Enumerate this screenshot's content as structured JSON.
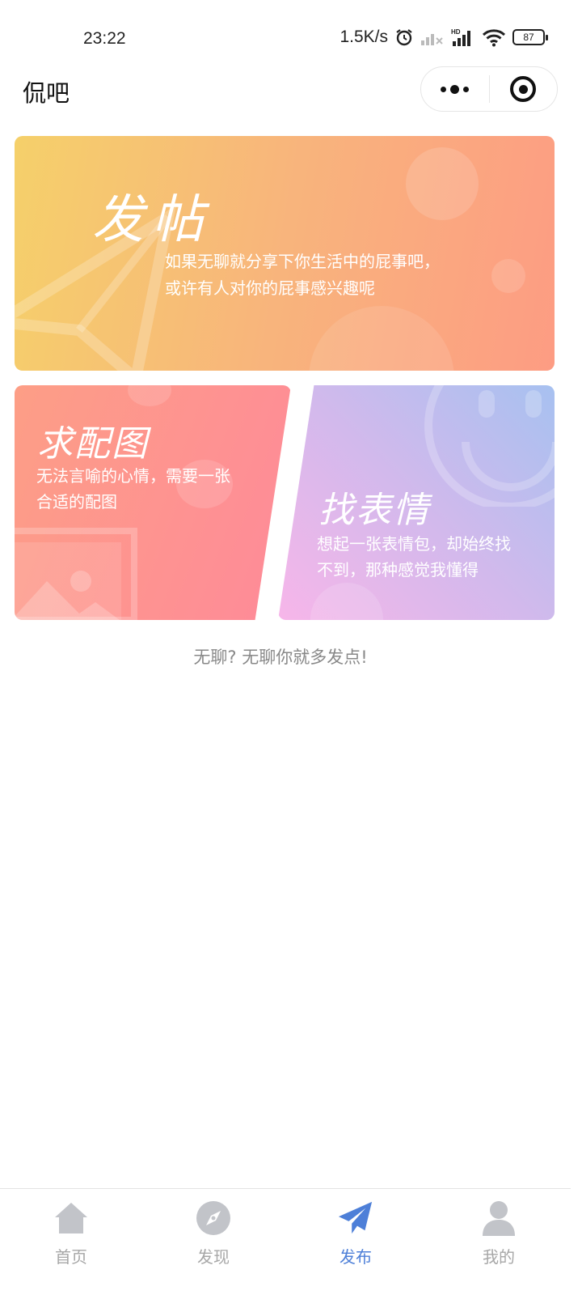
{
  "status_bar": {
    "time": "23:22",
    "net_speed": "1.5K/s",
    "battery": "87",
    "icons": [
      "alarm-icon",
      "signal-icon",
      "signal-hd-icon",
      "wifi-icon",
      "battery-icon"
    ]
  },
  "nav": {
    "title": "侃吧",
    "more_icon": "more-dots-icon",
    "close_icon": "target-icon"
  },
  "cards": {
    "post": {
      "title": "发帖",
      "desc_line1": "如果无聊就分享下你生活中的屁事吧，",
      "desc_line2": "或许有人对你的屁事感兴趣呢"
    },
    "image": {
      "title": "求配图",
      "desc_line1": "无法言喻的心情，需要一张",
      "desc_line2": "合适的配图"
    },
    "emoji": {
      "title": "找表情",
      "desc_line1": "想起一张表情包，却始终找",
      "desc_line2": "不到，那种感觉我懂得"
    }
  },
  "tagline": "无聊? 无聊你就多发点!",
  "tabs": [
    {
      "label": "首页",
      "icon": "home-icon",
      "active": false
    },
    {
      "label": "发现",
      "icon": "compass-icon",
      "active": false
    },
    {
      "label": "发布",
      "icon": "paper-plane-icon",
      "active": true
    },
    {
      "label": "我的",
      "icon": "user-icon",
      "active": false
    }
  ],
  "colors": {
    "accent": "#4d7fd8",
    "tab_inactive": "#a7a7a7",
    "post_gradient": [
      "#f5d06a",
      "#fd9c83"
    ],
    "image_gradient": [
      "#fd9e86",
      "#fe8a99"
    ],
    "emoji_gradient": [
      "#f7b6e9",
      "#a7c1f0"
    ]
  }
}
